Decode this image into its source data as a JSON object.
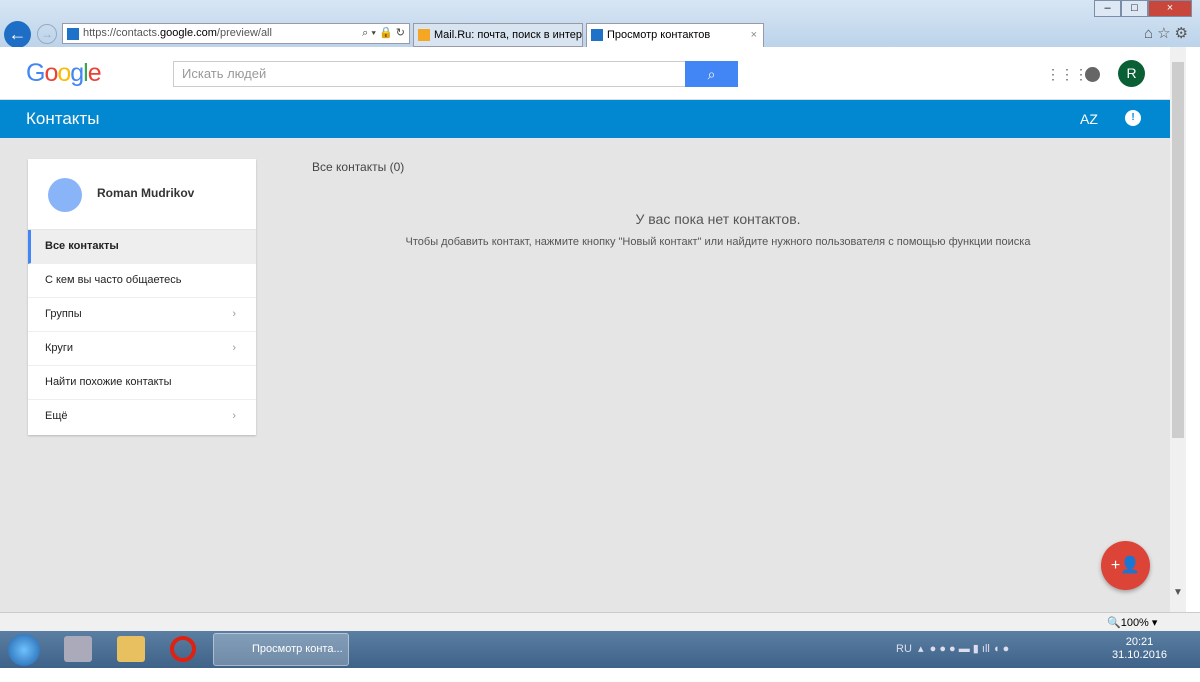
{
  "browser": {
    "url_prefix": "https://contacts.",
    "url_domain": "google.com",
    "url_path": "/preview/all",
    "tabs": [
      {
        "label": "Mail.Ru: почта, поиск в интер..."
      },
      {
        "label": "Просмотр контактов",
        "close": "×"
      }
    ],
    "zoom": "100%"
  },
  "header": {
    "logo": "Google",
    "search_placeholder": "Искать людей",
    "avatar_letter": "R"
  },
  "appbar": {
    "title": "Контакты",
    "sort": "AZ",
    "feedback": "!"
  },
  "sidebar": {
    "user": "Roman Mudrikov",
    "items": [
      {
        "label": "Все контакты"
      },
      {
        "label": "С кем вы часто общаетесь"
      },
      {
        "label": "Группы"
      },
      {
        "label": "Круги"
      },
      {
        "label": "Найти похожие контакты"
      },
      {
        "label": "Ещё"
      }
    ]
  },
  "main": {
    "heading": "Все контакты (0)",
    "empty_title": "У вас пока нет контактов.",
    "empty_hint": "Чтобы добавить контакт, нажмите кнопку \"Новый контакт\" или найдите нужного пользователя с помощью функции поиска"
  },
  "taskbar": {
    "task_label": "Просмотр конта...",
    "lang": "RU",
    "time": "20:21",
    "date": "31.10.2016"
  }
}
